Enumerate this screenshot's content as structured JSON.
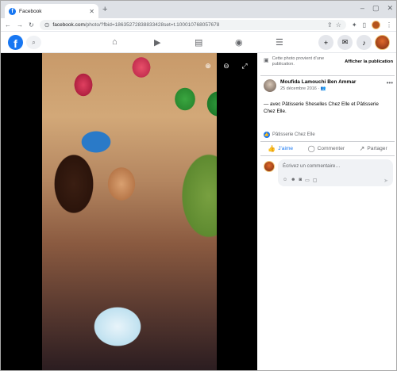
{
  "browser": {
    "tab_title": "Facebook",
    "tab_close": "✕",
    "new_tab": "+",
    "url_host": "facebook.com",
    "url_rest": "/photo/?fbid=18635272838833428set=t.100010768057678"
  },
  "fb_nav": {
    "logo": "f",
    "icons": [
      "home-icon",
      "video-icon",
      "marketplace-icon",
      "groups-icon",
      "menu-icon"
    ],
    "right_icons": [
      "create-icon",
      "messenger-icon",
      "notifications-icon"
    ]
  },
  "notice": {
    "text": "Cette photo provient d'une publication.",
    "link": "Afficher la publication"
  },
  "post": {
    "author": "Moufida Lamouchi Ben Ammar",
    "date": "25 décembre 2016 ·",
    "caption": "— avec Pâtisserie Sheselles Chez Elle et Pâtisserie Chez Elle.",
    "reaction_name": "Pâtisserie Chez Elle"
  },
  "actions": {
    "like": "J'aime",
    "comment": "Commenter",
    "share": "Partager"
  },
  "comment": {
    "placeholder": "Écrivez un commentaire…"
  },
  "colors": {
    "fb_blue": "#1877f2",
    "secondary_text": "#65676b"
  }
}
